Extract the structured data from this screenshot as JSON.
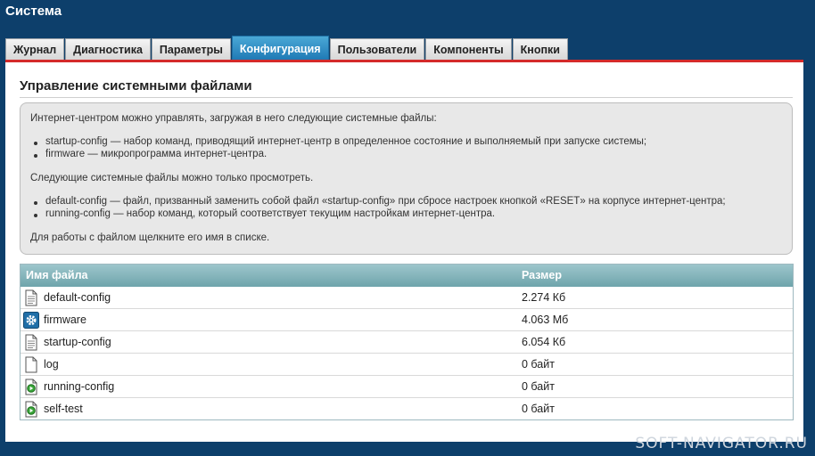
{
  "app": {
    "title": "Система"
  },
  "tabs": [
    {
      "label": "Журнал"
    },
    {
      "label": "Диагностика"
    },
    {
      "label": "Параметры"
    },
    {
      "label": "Конфигурация",
      "active": true
    },
    {
      "label": "Пользователи"
    },
    {
      "label": "Компоненты"
    },
    {
      "label": "Кнопки"
    }
  ],
  "section": {
    "title": "Управление системными файлами"
  },
  "info": {
    "intro": "Интернет-центром можно управлять, загружая в него следующие системные файлы:",
    "managed": [
      "startup-config — набор команд, приводящий интернет-центр в определенное состояние и выполняемый при запуске системы;",
      "firmware — микропрограмма интернет-центра."
    ],
    "view_intro": "Следующие системные файлы можно только просмотреть.",
    "readonly": [
      "default-config — файл, призванный заменить собой файл «startup-config» при сбросе настроек кнопкой «RESET» на корпусе интернет-центра;",
      "running-config — набор команд, который соответствует текущим настройкам интернет-центра."
    ],
    "hint": "Для работы с файлом щелкните его имя в списке."
  },
  "files": {
    "header": {
      "name": "Имя файла",
      "size": "Размер"
    },
    "rows": [
      {
        "name": "default-config",
        "size": "2.274 Кб",
        "icon": "document-icon"
      },
      {
        "name": "firmware",
        "size": "4.063 Мб",
        "icon": "gear-icon"
      },
      {
        "name": "startup-config",
        "size": "6.054 Кб",
        "icon": "document-icon"
      },
      {
        "name": "log",
        "size": "0 байт",
        "icon": "document-icon"
      },
      {
        "name": "running-config",
        "size": "0 байт",
        "icon": "live-document-icon"
      },
      {
        "name": "self-test",
        "size": "0 байт",
        "icon": "live-document-icon"
      }
    ]
  },
  "watermark": "SOFT-NAVIGATOR.RU"
}
